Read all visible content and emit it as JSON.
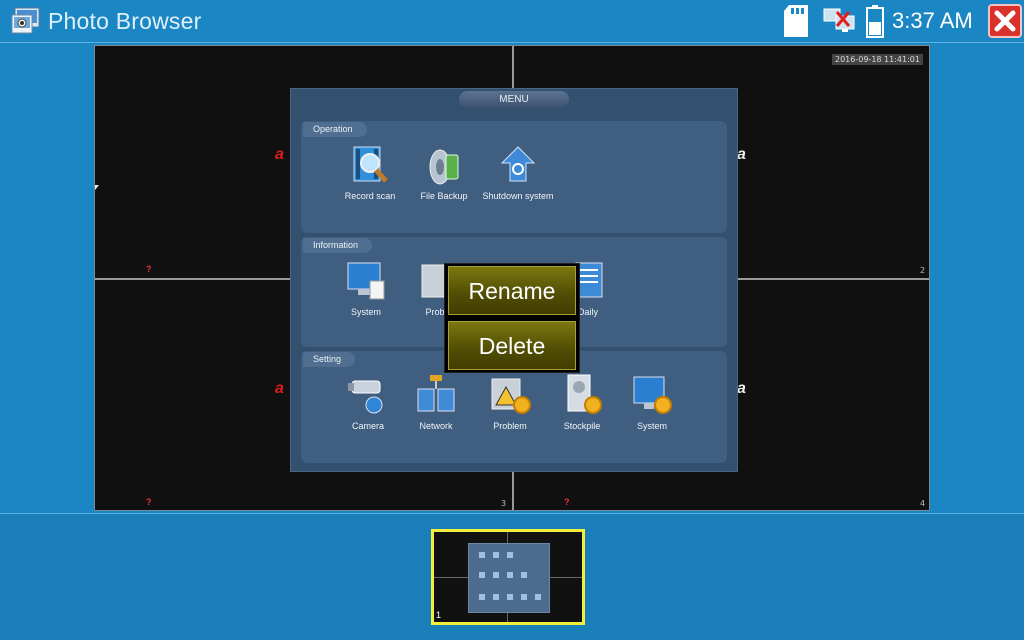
{
  "app": {
    "title": "Photo Browser",
    "clock": "3:37 AM"
  },
  "viewer": {
    "timestamp": "2016-09-18 11:41:01",
    "channels": [
      "2",
      "3",
      "4"
    ],
    "qmark": "?",
    "logo_letter": "a"
  },
  "menu": {
    "title": "MENU",
    "sections": {
      "operation": {
        "label": "Operation",
        "items": [
          "Record scan",
          "File Backup",
          "Shutdown system"
        ]
      },
      "information": {
        "label": "Information",
        "items": [
          "System",
          "Probl",
          "Daily"
        ]
      },
      "setting": {
        "label": "Setting",
        "items": [
          "Camera",
          "Network",
          "Problem",
          "Stockpile",
          "System"
        ]
      }
    }
  },
  "popup": {
    "rename": "Rename",
    "delete": "Delete"
  },
  "thumbnails": {
    "selected_number": "1"
  },
  "icons": {
    "app": "photo-browser-icon",
    "sd": "sd-card-icon",
    "network": "network-disconnected-icon",
    "battery": "battery-icon",
    "close": "close-icon"
  },
  "colors": {
    "topbar": "#1a86c4",
    "close": "#d9312b",
    "popup_button": "#5a5608",
    "thumb_border": "#f3ee3b",
    "menu_bg": "#33506f"
  }
}
